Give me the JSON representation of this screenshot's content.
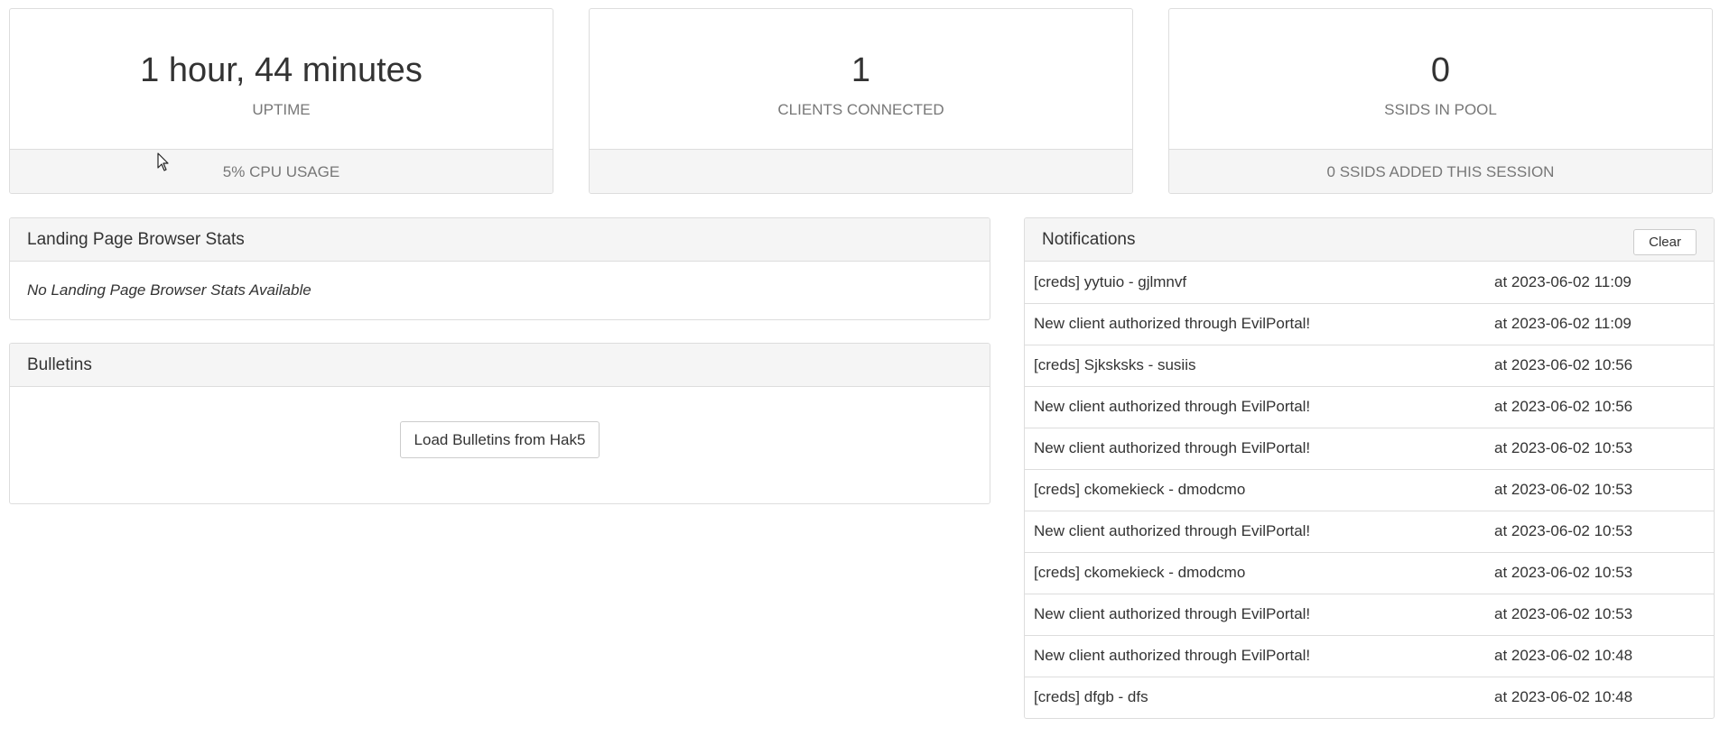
{
  "stats": [
    {
      "value": "1 hour, 44 minutes",
      "label": "UPTIME",
      "footer": "5% CPU USAGE"
    },
    {
      "value": "1",
      "label": "CLIENTS CONNECTED",
      "footer": ""
    },
    {
      "value": "0",
      "label": "SSIDS IN POOL",
      "footer": "0 SSIDS ADDED THIS SESSION"
    }
  ],
  "landing": {
    "title": "Landing Page Browser Stats",
    "empty_message": "No Landing Page Browser Stats Available"
  },
  "bulletins": {
    "title": "Bulletins",
    "load_button": "Load Bulletins from Hak5"
  },
  "notifications": {
    "title": "Notifications",
    "clear_button": "Clear",
    "items": [
      {
        "message": "[creds] yytuio - gjlmnvf",
        "time": "at 2023-06-02 11:09"
      },
      {
        "message": "New client authorized through EvilPortal!",
        "time": "at 2023-06-02 11:09"
      },
      {
        "message": "[creds] Sjksksks - susiis",
        "time": "at 2023-06-02 10:56"
      },
      {
        "message": "New client authorized through EvilPortal!",
        "time": "at 2023-06-02 10:56"
      },
      {
        "message": "New client authorized through EvilPortal!",
        "time": "at 2023-06-02 10:53"
      },
      {
        "message": "[creds] ckomekieck - dmodcmo",
        "time": "at 2023-06-02 10:53"
      },
      {
        "message": "New client authorized through EvilPortal!",
        "time": "at 2023-06-02 10:53"
      },
      {
        "message": "[creds] ckomekieck - dmodcmo",
        "time": "at 2023-06-02 10:53"
      },
      {
        "message": "New client authorized through EvilPortal!",
        "time": "at 2023-06-02 10:53"
      },
      {
        "message": "New client authorized through EvilPortal!",
        "time": "at 2023-06-02 10:48"
      },
      {
        "message": "[creds] dfgb - dfs",
        "time": "at 2023-06-02 10:48"
      }
    ]
  }
}
